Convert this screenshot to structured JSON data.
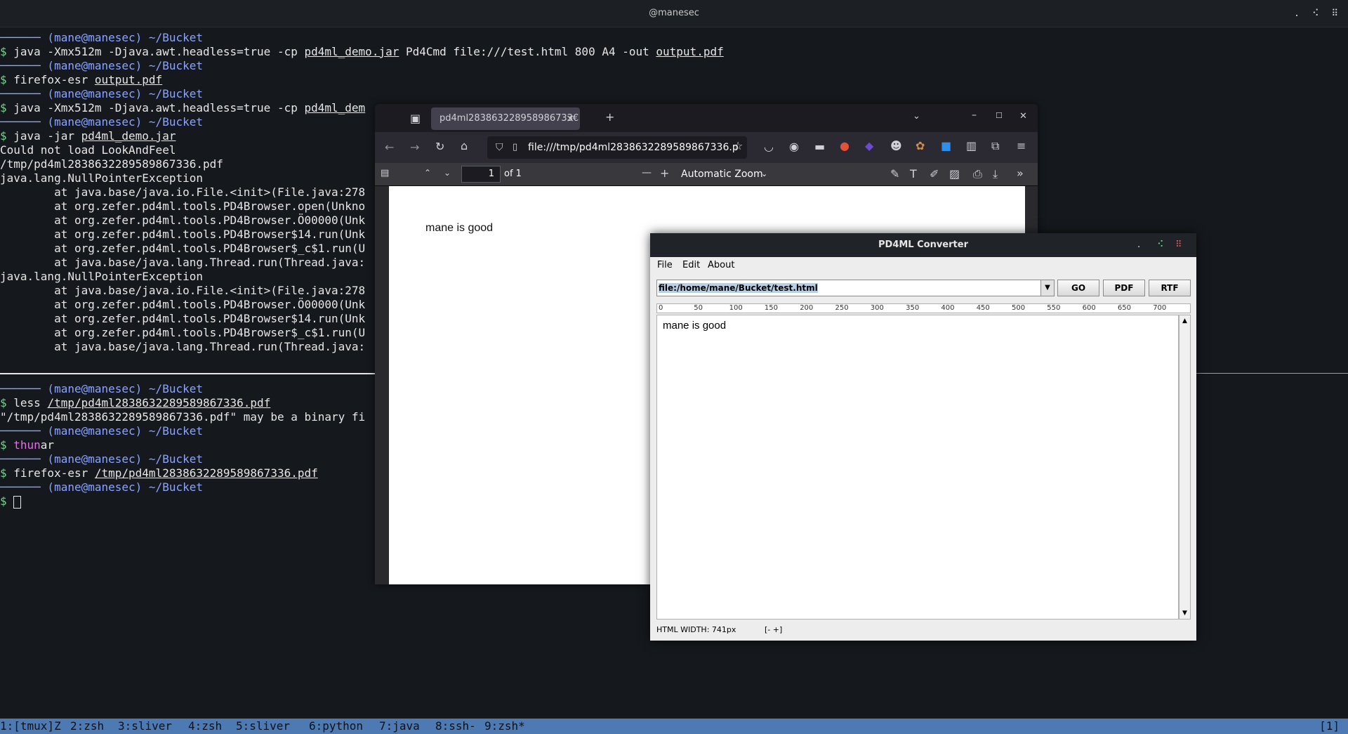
{
  "topbar": {
    "title": "@manesec",
    "controls": [
      ".",
      "⠪",
      "⠿"
    ]
  },
  "terminal": {
    "lines": [
      {
        "prompt": "────── (mane@manesec) ~/Bucket"
      },
      {
        "cmd": "$ ",
        "text": "java -Xmx512m -Djava.awt.headless=true -cp ",
        "u1": "pd4ml_demo.jar",
        "text2": " Pd4Cmd file:///test.html 800 A4 -out ",
        "u2": "output.pdf"
      },
      {
        "prompt": "────── (mane@manesec) ~/Bucket"
      },
      {
        "cmd": "$ ",
        "text": "firefox-esr ",
        "u1": "output.pdf"
      },
      {
        "prompt": "────── (mane@manesec) ~/Bucket"
      },
      {
        "cmd": "$ ",
        "text": "java -Xmx512m -Djava.awt.headless=true -cp ",
        "u1": "pd4ml_dem"
      },
      {
        "prompt": "────── (mane@manesec) ~/Bucket"
      },
      {
        "cmd": "$ ",
        "text": "java -jar ",
        "u1": "pd4ml_demo.jar"
      },
      {
        "plain": "Could not load LookAndFeel"
      },
      {
        "plain": "/tmp/pd4ml283863228958986733​6.pdf"
      },
      {
        "plain": "java.lang.NullPointerException"
      },
      {
        "plain": "        at java.base/java.io.File.<init>(File.java:278"
      },
      {
        "plain": "        at org.zefer.pd4ml.tools.PD4Browser.open(Unkno"
      },
      {
        "plain": "        at org.zefer.pd4ml.tools.PD4Browser.Ö00000(Unk"
      },
      {
        "plain": "        at org.zefer.pd4ml.tools.PD4Browser$14.run(Unk"
      },
      {
        "plain": "        at org.zefer.pd4ml.tools.PD4Browser$_c$1.run(U"
      },
      {
        "plain": "        at java.base/java.lang.Thread.run(Thread.java:"
      },
      {
        "plain": "java.lang.NullPointerException"
      },
      {
        "plain": "        at java.base/java.io.File.<init>(File.java:278"
      },
      {
        "plain": "        at org.zefer.pd4ml.tools.PD4Browser.Ö00000(Unk"
      },
      {
        "plain": "        at org.zefer.pd4ml.tools.PD4Browser$14.run(Unk"
      },
      {
        "plain": "        at org.zefer.pd4ml.tools.PD4Browser$_c$1.run(U"
      },
      {
        "plain": "        at java.base/java.lang.Thread.run(Thread.java:"
      },
      {
        "plain": ""
      },
      {
        "plain": ""
      },
      {
        "prompt": "────── (mane@manesec) ~/Bucket"
      },
      {
        "cmd": "$ ",
        "text": "less ",
        "u1": "/tmp/pd4ml2838632289589867336.pdf"
      },
      {
        "plain": "\"/tmp/pd4ml2838632289589867336.pdf\" may be a binary fi"
      },
      {
        "prompt": "────── (mane@manesec) ~/Bucket"
      },
      {
        "cmd": "$ ",
        "mag": "thun",
        "text": "ar"
      },
      {
        "prompt": "────── (mane@manesec) ~/Bucket"
      },
      {
        "cmd": "$ ",
        "text": "firefox-esr ",
        "u1": "/tmp/pd4ml2838632289589867336.pdf"
      },
      {
        "prompt": "────── (mane@manesec) ~/Bucket"
      },
      {
        "cmd": "$ ",
        "cursor": true
      }
    ]
  },
  "firefox": {
    "tab_title": "pd4ml283863228958986733€",
    "tab_close": "×",
    "new_tab": "+",
    "url": "file:///tmp/pd4ml2838632289589867336.p",
    "page_number": "1",
    "page_count": "of 1",
    "zoom": "Automatic Zoom",
    "pdf_text": "mane is good"
  },
  "pd4ml": {
    "title": "PD4ML Converter",
    "menu": [
      "File",
      "Edit",
      "About"
    ],
    "url_value": "file:/home/mane/Bucket/test.html",
    "buttons": [
      "GO",
      "PDF",
      "RTF"
    ],
    "ruler_ticks": [
      "0",
      "50",
      "100",
      "150",
      "200",
      "250",
      "300",
      "350",
      "400",
      "450",
      "500",
      "550",
      "600",
      "650",
      "700"
    ],
    "content_text": "mane is good",
    "status_width": "HTML WIDTH: 741px",
    "status_zoom": "[-  +]"
  },
  "tmux": {
    "windows": [
      "1:[tmux]Z",
      "2:zsh",
      "3:sliver",
      "4:zsh",
      "5:sliver",
      "6:python",
      "7:java",
      "8:ssh-",
      "9:zsh*"
    ],
    "right": "[1]"
  }
}
